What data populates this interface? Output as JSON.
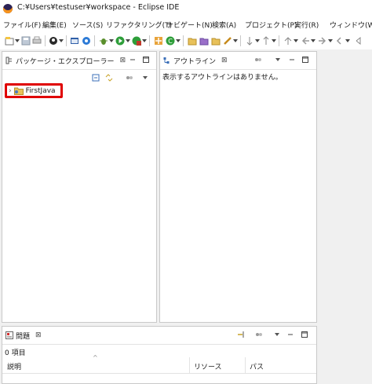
{
  "window": {
    "title": "C:¥Users¥testuser¥workspace - Eclipse IDE"
  },
  "menubar": {
    "items": [
      "ファイル(F)",
      "編集(E)",
      "ソース(S)",
      "リファクタリング(T)",
      "ナビゲート(N)",
      "検索(A)",
      "プロジェクト(P)",
      "実行(R)",
      "ウィンドウ(W)"
    ]
  },
  "package_explorer": {
    "tab_label": "パッケージ・エクスプローラー",
    "close_glyph": "⊠",
    "tree": [
      {
        "label": "FirstJava",
        "expander": "›"
      }
    ]
  },
  "outline": {
    "tab_label": "アウトライン",
    "close_glyph": "⊠",
    "message": "表示するアウトラインはありません。"
  },
  "problems": {
    "tab_label": "問題",
    "close_glyph": "⊠",
    "count_text": "0 項目",
    "columns": [
      "説明",
      "リソース",
      "パス"
    ],
    "sort_indicator": "^"
  },
  "colors": {
    "highlight_border": "#e00000",
    "folder_yellow": "#e8c15a",
    "eclipse_purple": "#2c2255"
  }
}
